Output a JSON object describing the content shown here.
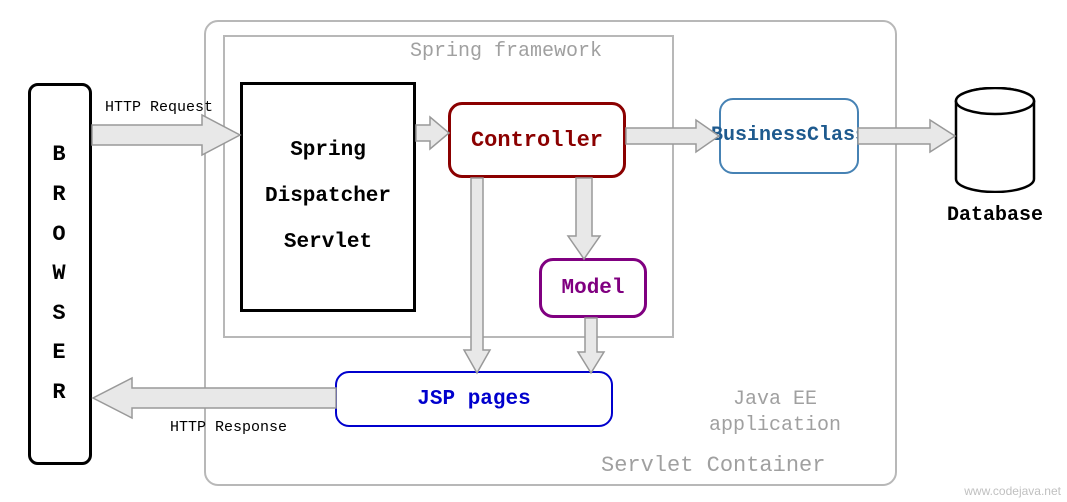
{
  "browser": {
    "label": "BROWSER"
  },
  "servletContainer": {
    "label": "Servlet Container"
  },
  "javaEE": {
    "label": "Java EE application"
  },
  "springFramework": {
    "label": "Spring framework"
  },
  "dispatcher": {
    "line1": "Spring",
    "line2": "Dispatcher",
    "line3": "Servlet"
  },
  "controller": {
    "label": "Controller"
  },
  "model": {
    "label": "Model"
  },
  "business": {
    "line1": "Business",
    "line2": "Class"
  },
  "jsp": {
    "label": "JSP pages"
  },
  "database": {
    "label": "Database"
  },
  "httpRequest": {
    "label": "HTTP Request"
  },
  "httpResponse": {
    "label": "HTTP Response"
  },
  "watermark": {
    "label": "www.codejava.net"
  }
}
